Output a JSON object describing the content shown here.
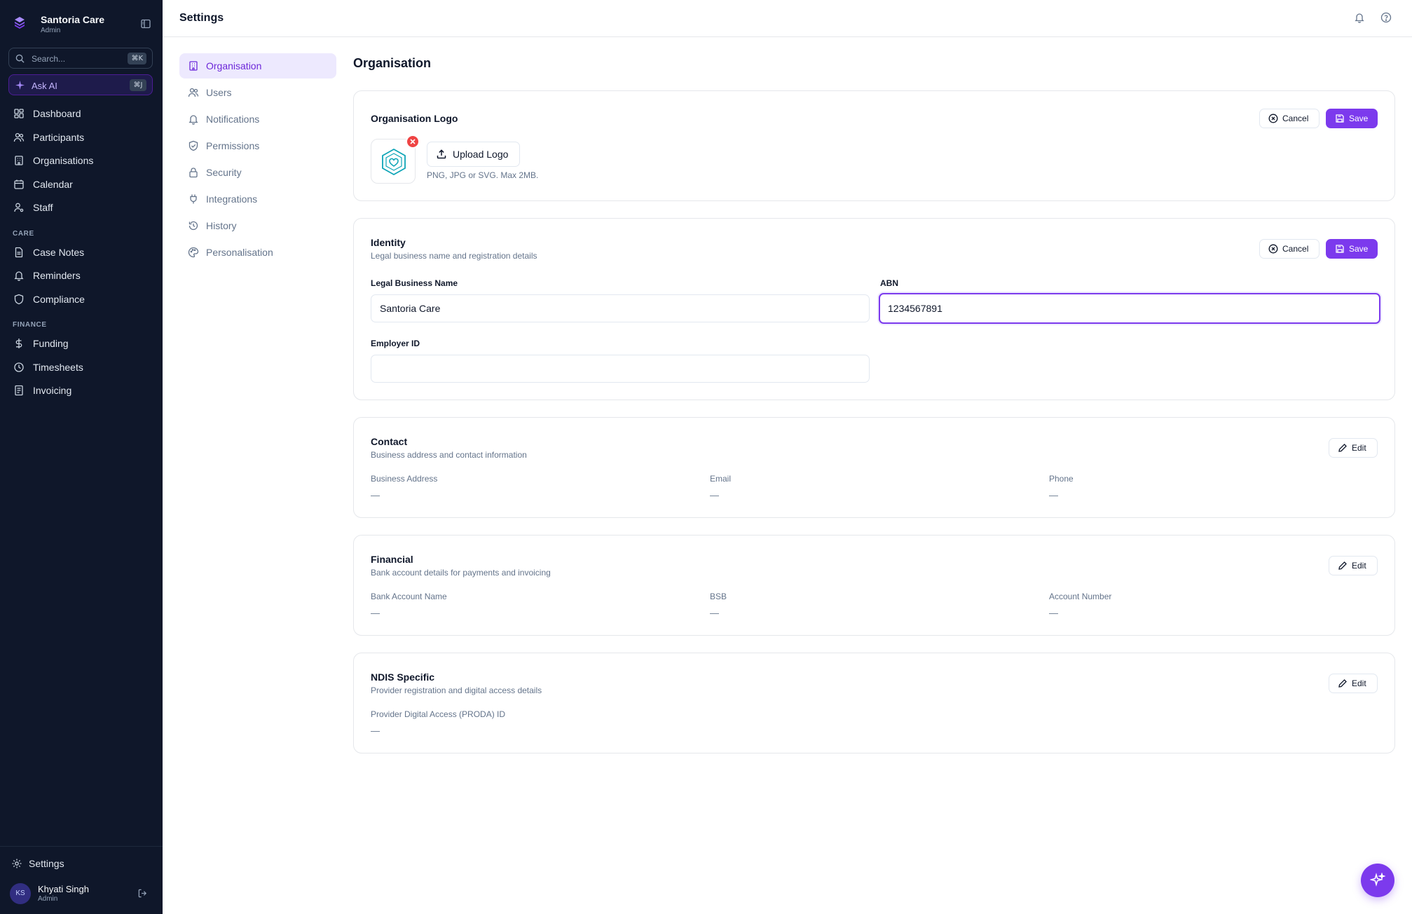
{
  "app": {
    "name": "Santoria Care",
    "role": "Admin"
  },
  "sidebar": {
    "search": {
      "placeholder": "Search...",
      "shortcut": "⌘K"
    },
    "ask_ai": {
      "label": "Ask AI",
      "shortcut": "⌘J"
    },
    "items": [
      {
        "label": "Dashboard",
        "icon": "dashboard-icon"
      },
      {
        "label": "Participants",
        "icon": "users-icon"
      },
      {
        "label": "Organisations",
        "icon": "building-icon"
      },
      {
        "label": "Calendar",
        "icon": "calendar-icon"
      },
      {
        "label": "Staff",
        "icon": "staff-icon"
      }
    ],
    "sections": [
      {
        "title": "CARE",
        "items": [
          {
            "label": "Case Notes",
            "icon": "file-icon"
          },
          {
            "label": "Reminders",
            "icon": "bell-icon"
          },
          {
            "label": "Compliance",
            "icon": "shield-icon"
          }
        ]
      },
      {
        "title": "FINANCE",
        "items": [
          {
            "label": "Funding",
            "icon": "dollar-icon"
          },
          {
            "label": "Timesheets",
            "icon": "clock-icon"
          },
          {
            "label": "Invoicing",
            "icon": "receipt-icon"
          }
        ]
      }
    ],
    "settings_label": "Settings",
    "user": {
      "initials": "KS",
      "name": "Khyati Singh",
      "role": "Admin"
    }
  },
  "header": {
    "title": "Settings"
  },
  "settings_nav": [
    {
      "label": "Organisation",
      "active": true,
      "icon": "building-icon"
    },
    {
      "label": "Users",
      "active": false,
      "icon": "users-icon"
    },
    {
      "label": "Notifications",
      "active": false,
      "icon": "bell-icon"
    },
    {
      "label": "Permissions",
      "active": false,
      "icon": "shield-check-icon"
    },
    {
      "label": "Security",
      "active": false,
      "icon": "lock-icon"
    },
    {
      "label": "Integrations",
      "active": false,
      "icon": "plug-icon"
    },
    {
      "label": "History",
      "active": false,
      "icon": "history-icon"
    },
    {
      "label": "Personalisation",
      "active": false,
      "icon": "palette-icon"
    }
  ],
  "main": {
    "title": "Organisation",
    "logo_card": {
      "title": "Organisation Logo",
      "cancel_label": "Cancel",
      "save_label": "Save",
      "upload_label": "Upload Logo",
      "hint": "PNG, JPG or SVG. Max 2MB."
    },
    "identity": {
      "title": "Identity",
      "description": "Legal business name and registration details",
      "cancel_label": "Cancel",
      "save_label": "Save",
      "legal_name": {
        "label": "Legal Business Name",
        "value": "Santoria Care"
      },
      "abn": {
        "label": "ABN",
        "value": "1234567891"
      },
      "employer_id": {
        "label": "Employer ID",
        "value": ""
      }
    },
    "contact": {
      "title": "Contact",
      "description": "Business address and contact information",
      "edit_label": "Edit",
      "fields": [
        {
          "label": "Business Address",
          "value": "—"
        },
        {
          "label": "Email",
          "value": "—"
        },
        {
          "label": "Phone",
          "value": "—"
        }
      ]
    },
    "financial": {
      "title": "Financial",
      "description": "Bank account details for payments and invoicing",
      "edit_label": "Edit",
      "fields": [
        {
          "label": "Bank Account Name",
          "value": "—"
        },
        {
          "label": "BSB",
          "value": "—"
        },
        {
          "label": "Account Number",
          "value": "—"
        }
      ]
    },
    "ndis": {
      "title": "NDIS Specific",
      "description": "Provider registration and digital access details",
      "edit_label": "Edit",
      "fields": [
        {
          "label": "Provider Digital Access (PRODA) ID",
          "value": "—"
        }
      ]
    }
  },
  "colors": {
    "sidebar_bg": "#0f172a",
    "accent": "#7c3aed",
    "accent_soft": "#ede9fe",
    "danger": "#ef4444"
  }
}
